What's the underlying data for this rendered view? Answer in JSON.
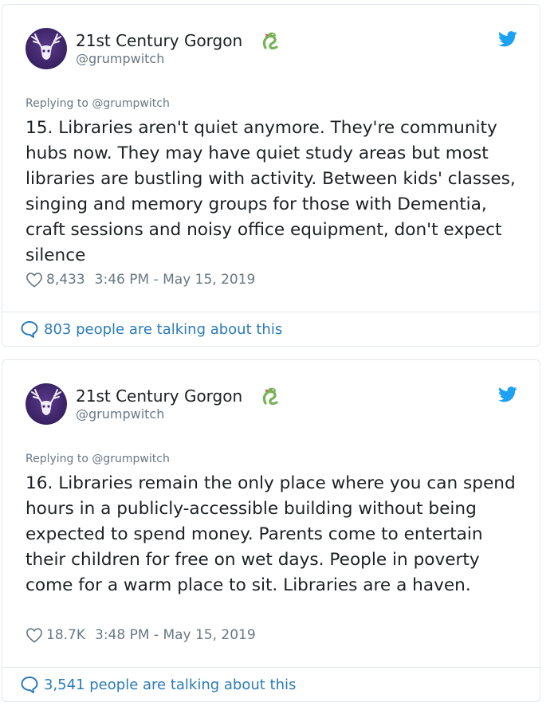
{
  "tweets": [
    {
      "display_name": "21st Century Gorgon",
      "handle": "@grumpwitch",
      "reply_to": "Replying to @grumpwitch",
      "text": "15. Libraries aren't quiet anymore. They're community hubs now. They may have quiet study areas but most libraries are bustling with activity. Between kids' classes, singing and memory groups for those with Dementia, craft sessions and noisy office equipment, don't expect silence",
      "likes": "8,433",
      "timestamp": "3:46 PM - May 15, 2019",
      "talking": "803 people are talking about this"
    },
    {
      "display_name": "21st Century Gorgon",
      "handle": "@grumpwitch",
      "reply_to": "Replying to @grumpwitch",
      "text": "16. Libraries remain the only place where you can spend hours in a publicly-accessible building without being expected to spend money. Parents come to entertain their children for free on wet days. People in poverty come for a warm place to sit. Libraries are a haven.",
      "likes": "18.7K",
      "timestamp": "3:48 PM - May 15, 2019",
      "talking": "3,541 people are talking about this"
    }
  ],
  "icons": {
    "avatar": "deer-skull-avatar",
    "name_emoji": "snake-icon",
    "brand": "twitter-bird-icon",
    "like": "heart-icon",
    "conversation": "speech-bubble-icon"
  },
  "colors": {
    "text": "#1c2022",
    "muted": "#697882",
    "link": "#2b7bb9",
    "twitter_blue": "#1da1f2",
    "border": "#e1e8ed",
    "snake_green": "#77b255"
  }
}
